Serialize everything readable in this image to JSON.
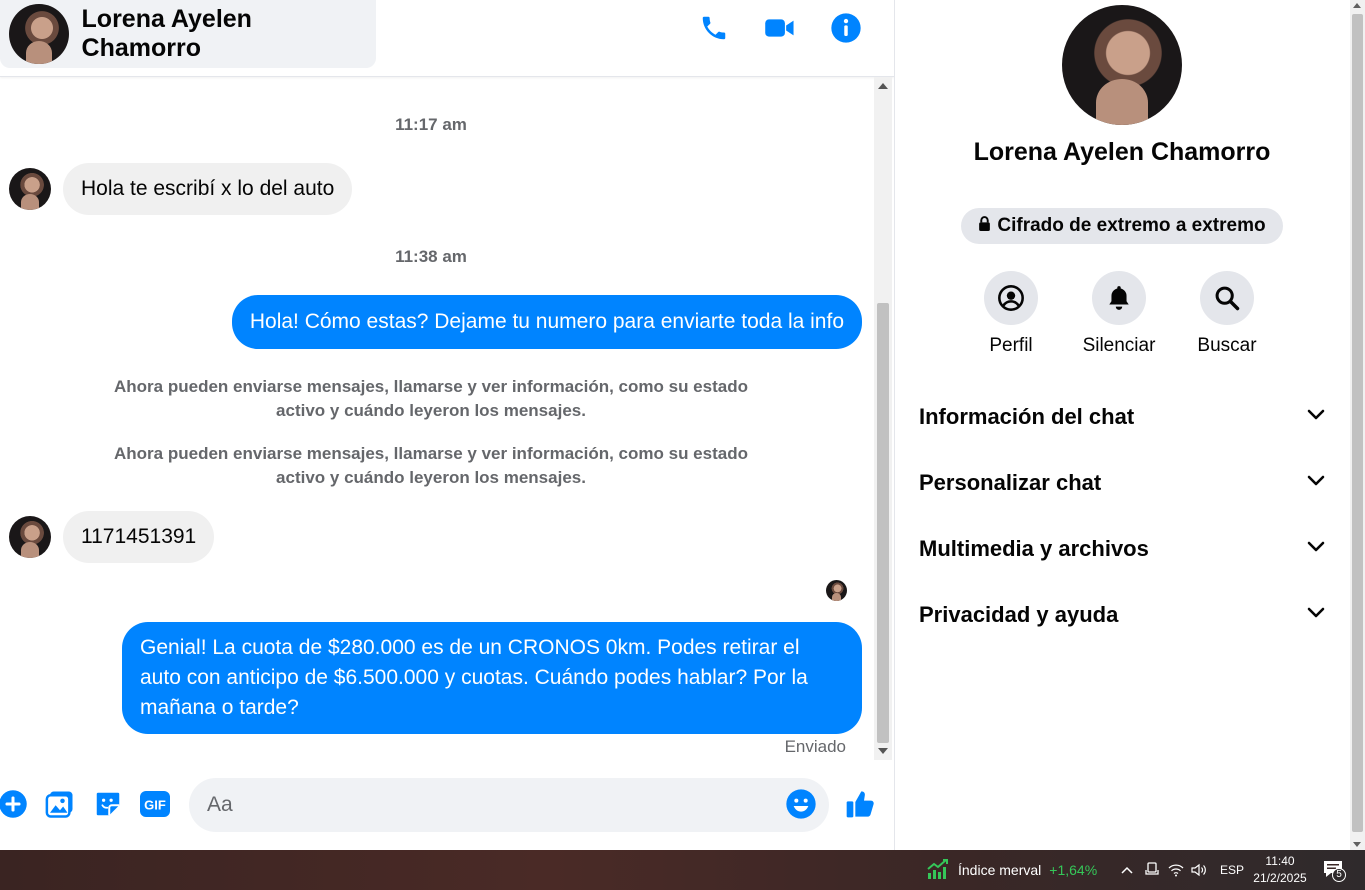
{
  "header": {
    "contact_name": "Lorena Ayelen Chamorro",
    "icons": [
      "phone-icon",
      "video-icon",
      "info-icon"
    ]
  },
  "messages": {
    "timestamp_1": "11:17 am",
    "incoming_1": "Hola te escribí x lo del auto",
    "timestamp_2": "11:38 am",
    "outgoing_1": "Hola! Cómo estas? Dejame tu numero para enviarte toda la info",
    "system_1": "Ahora pueden enviarse mensajes, llamarse y ver información, como su estado activo y cuándo leyeron los mensajes.",
    "system_2": "Ahora pueden enviarse mensajes, llamarse y ver información, como su estado activo y cuándo leyeron los mensajes.",
    "incoming_2": "1171451391",
    "outgoing_2": "Genial! La cuota de $280.000 es de un CRONOS 0km. Podes retirar el auto con anticipo de $6.500.000 y cuotas. Cuándo podes hablar? Por la mañana o tarde?",
    "status": "Enviado"
  },
  "composer": {
    "placeholder": "Aa",
    "icons": [
      "plus-icon",
      "image-icon",
      "sticker-icon",
      "gif-icon",
      "emoji-icon",
      "thumbs-up-icon"
    ],
    "gif_label": "GIF"
  },
  "info_panel": {
    "name": "Lorena Ayelen Chamorro",
    "encryption": "Cifrado de extremo a extremo",
    "actions": [
      {
        "label": "Perfil",
        "icon": "profile-icon"
      },
      {
        "label": "Silenciar",
        "icon": "bell-icon"
      },
      {
        "label": "Buscar",
        "icon": "search-icon"
      }
    ],
    "sections": [
      {
        "label": "Información del chat"
      },
      {
        "label": "Personalizar chat"
      },
      {
        "label": "Multimedia y archivos"
      },
      {
        "label": "Privacidad y ayuda"
      }
    ]
  },
  "taskbar": {
    "widget_label": "Índice merval",
    "widget_value": "+1,64%",
    "language": "ESP",
    "time": "11:40",
    "date": "21/2/2025",
    "notification_count": "5"
  },
  "colors": {
    "accent": "#0084ff",
    "bubble_in": "#f0f0f0",
    "muted_text": "#65676b",
    "taskbar_green": "#35c759"
  }
}
